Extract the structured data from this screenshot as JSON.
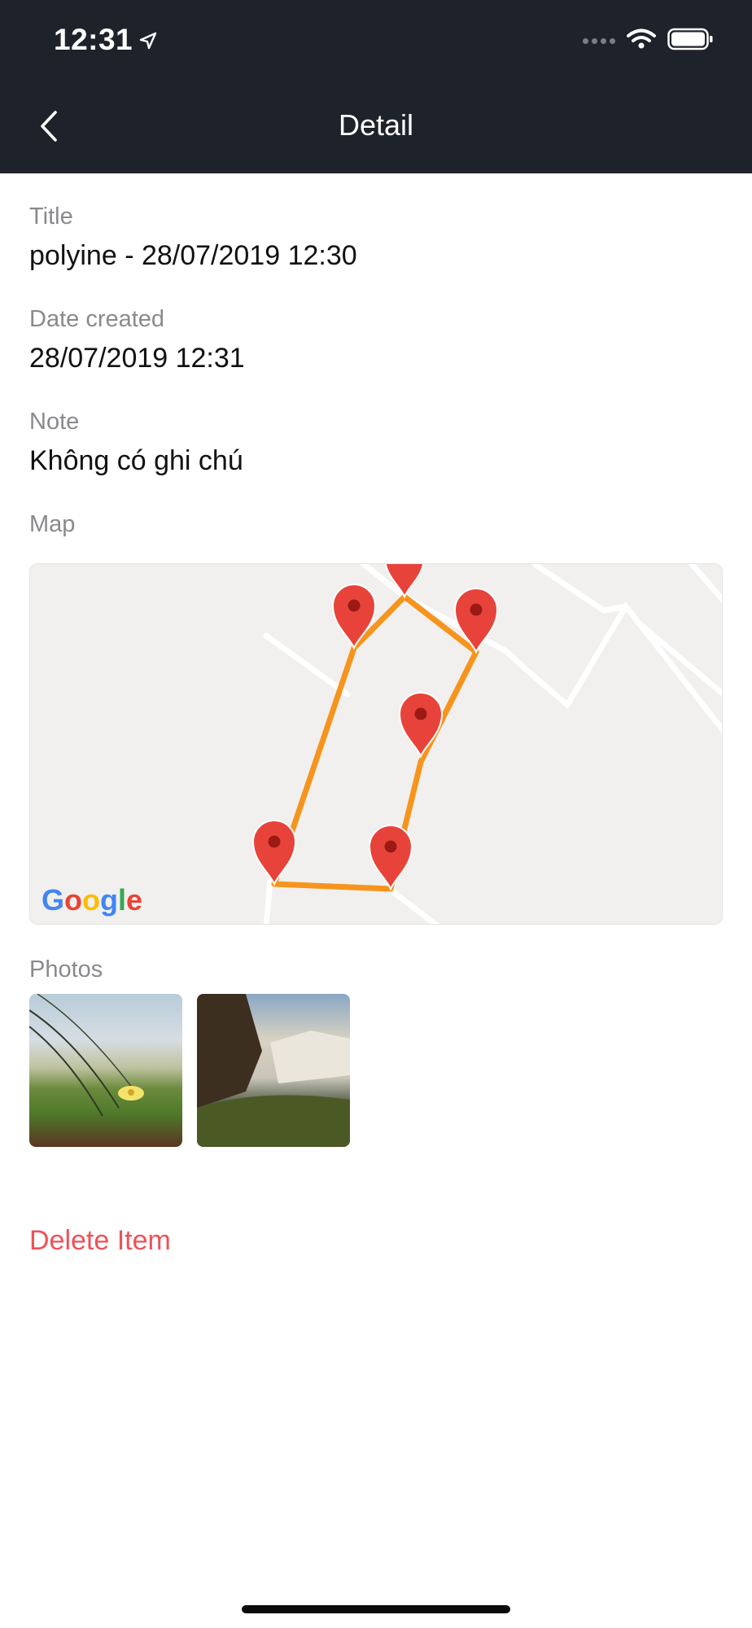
{
  "status_bar": {
    "time": "12:31"
  },
  "nav": {
    "title": "Detail"
  },
  "fields": [
    {
      "label": "Title",
      "value": "polyine - 28/07/2019 12:30"
    },
    {
      "label": "Date created",
      "value": "28/07/2019 12:31"
    },
    {
      "label": "Note",
      "value": "Không có ghi chú"
    }
  ],
  "map_section": {
    "label": "Map",
    "provider_logo": "Google"
  },
  "photos_section": {
    "label": "Photos",
    "count": 2
  },
  "actions": {
    "delete_label": "Delete Item"
  },
  "colors": {
    "accent_delete": "#ef5158",
    "route": "#f7941d",
    "marker": "#e8433a",
    "topbar": "#1e222b"
  }
}
